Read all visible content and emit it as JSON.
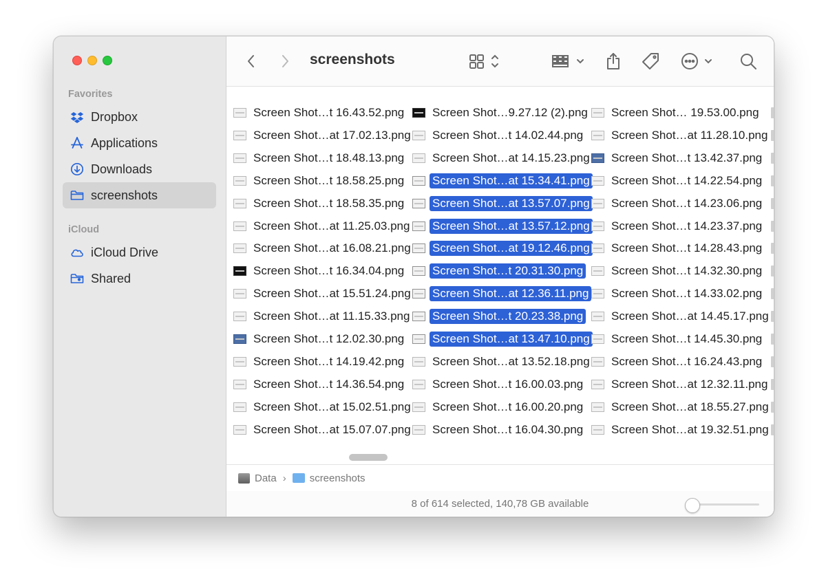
{
  "sidebar": {
    "favorites_heading": "Favorites",
    "icloud_heading": "iCloud",
    "items": [
      {
        "label": "Dropbox",
        "icon": "dropbox-icon"
      },
      {
        "label": "Applications",
        "icon": "applications-icon"
      },
      {
        "label": "Downloads",
        "icon": "downloads-icon"
      },
      {
        "label": "screenshots",
        "icon": "folder-icon",
        "selected": true
      }
    ],
    "icloud_items": [
      {
        "label": "iCloud Drive",
        "icon": "cloud-icon"
      },
      {
        "label": "Shared",
        "icon": "shared-folder-icon"
      }
    ]
  },
  "toolbar": {
    "title": "screenshots"
  },
  "files": {
    "col1": [
      "Screen Shot…t 16.43.52.png",
      "Screen Shot…at 17.02.13.png",
      "Screen Shot…t 18.48.13.png",
      "Screen Shot…t 18.58.25.png",
      "Screen Shot…t 18.58.35.png",
      "Screen Shot…at 11.25.03.png",
      "Screen Shot…at 16.08.21.png",
      "Screen Shot…t 16.34.04.png",
      "Screen Shot…at 15.51.24.png",
      "Screen Shot…at 11.15.33.png",
      "Screen Shot…t 12.02.30.png",
      "Screen Shot…t 14.19.42.png",
      "Screen Shot…t 14.36.54.png",
      "Screen Shot…at 15.02.51.png",
      "Screen Shot…at 15.07.07.png"
    ],
    "col2": [
      "Screen Shot…9.27.12 (2).png",
      "Screen Shot…t 14.02.44.png",
      "Screen Shot…at 14.15.23.png",
      "Screen Shot…at 15.34.41.png",
      "Screen Shot…at 13.57.07.png",
      "Screen Shot…at 13.57.12.png",
      "Screen Shot…at 19.12.46.png",
      "Screen Shot…t 20.31.30.png",
      "Screen Shot…at 12.36.11.png",
      "Screen Shot…t 20.23.38.png",
      "Screen Shot…at 13.47.10.png",
      "Screen Shot…at 13.52.18.png",
      "Screen Shot…t 16.00.03.png",
      "Screen Shot…t 16.00.20.png",
      "Screen Shot…t 16.04.30.png"
    ],
    "col3": [
      "Screen Shot… 19.53.00.png",
      "Screen Shot…at 11.28.10.png",
      "Screen Shot…t 13.42.37.png",
      "Screen Shot…t 14.22.54.png",
      "Screen Shot…t 14.23.06.png",
      "Screen Shot…t 14.23.37.png",
      "Screen Shot…t 14.28.43.png",
      "Screen Shot…t 14.32.30.png",
      "Screen Shot…t 14.33.02.png",
      "Screen Shot…at 14.45.17.png",
      "Screen Shot…t 14.45.30.png",
      "Screen Shot…t 16.24.43.png",
      "Screen Shot…at 12.32.11.png",
      "Screen Shot…at 18.55.27.png",
      "Screen Shot…at 19.32.51.png"
    ],
    "col2_selected": [
      3,
      4,
      5,
      6,
      7,
      8,
      9,
      10
    ]
  },
  "pathbar": {
    "root": "Data",
    "folder": "screenshots"
  },
  "status": {
    "text": "8 of 614 selected, 140,78 GB available"
  },
  "slider": {
    "level": 0.0
  }
}
